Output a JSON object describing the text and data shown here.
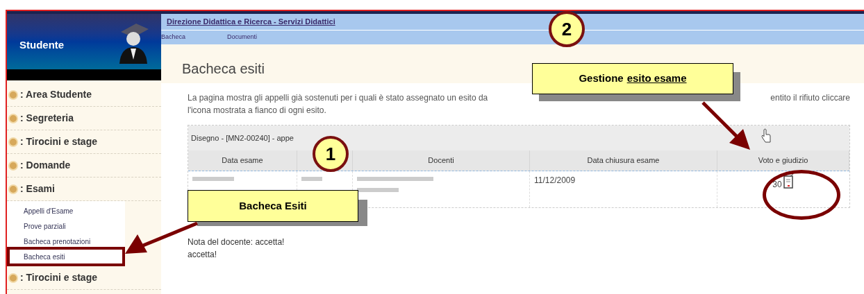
{
  "sidebar": {
    "title": "Studente",
    "items": [
      {
        "label": ": Area Studente"
      },
      {
        "label": ": Segreteria"
      },
      {
        "label": ": Tirocini e stage"
      },
      {
        "label": ": Domande"
      },
      {
        "label": ": Esami",
        "children": [
          {
            "label": "Appelli d'Esame"
          },
          {
            "label": "Prove parziali"
          },
          {
            "label": "Bacheca prenotazioni"
          },
          {
            "label": "Bacheca esiti"
          }
        ]
      },
      {
        "label": ": Tirocini e stage"
      }
    ]
  },
  "header": {
    "site_link": "Direzione Didattica e Ricerca - Servizi Didattici",
    "nav": [
      "Bacheca",
      "Documenti"
    ]
  },
  "page": {
    "title": "Bacheca esiti",
    "description_start": "La pagina mostra gli appelli già sostenuti per i quali è stato assegnato un esito da",
    "description_end": "entito il rifiuto cliccare",
    "description_line2": "l'icona mostrata a fianco di ogni esito.",
    "table": {
      "caption": "Disegno - [MN2-00240] - appe",
      "columns": [
        "Data esame",
        "",
        "Docenti",
        "Data chiusura esame",
        "Voto e giudizio"
      ],
      "rows": [
        {
          "column_4": "11/12/2009",
          "grade": "30"
        }
      ]
    },
    "note": "Nota del docente: accetta!",
    "note_text": "accetta!"
  },
  "annotations": [
    {
      "number": "2",
      "label": "Gestione",
      "label_underlined": "esito esame"
    },
    {
      "number": "1",
      "label": "Bacheca Esiti"
    }
  ]
}
